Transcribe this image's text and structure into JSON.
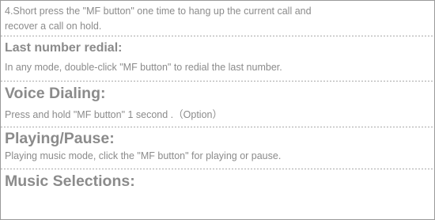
{
  "intro": {
    "line1": "4.Short press the \"MF button\" one time to hang up the current call and",
    "line2": "recover a call on hold."
  },
  "sections": [
    {
      "heading": "Last number redial:",
      "body": "In any mode, double-click \"MF button\" to redial the last  number."
    },
    {
      "heading": "Voice Dialing:",
      "body": "Press and hold  \"MF button\" 1 second .（Option）"
    },
    {
      "heading": "Playing/Pause:",
      "body": "Playing music mode, click the \"MF button\" for playing or pause."
    },
    {
      "heading": "Music Selections:"
    }
  ]
}
